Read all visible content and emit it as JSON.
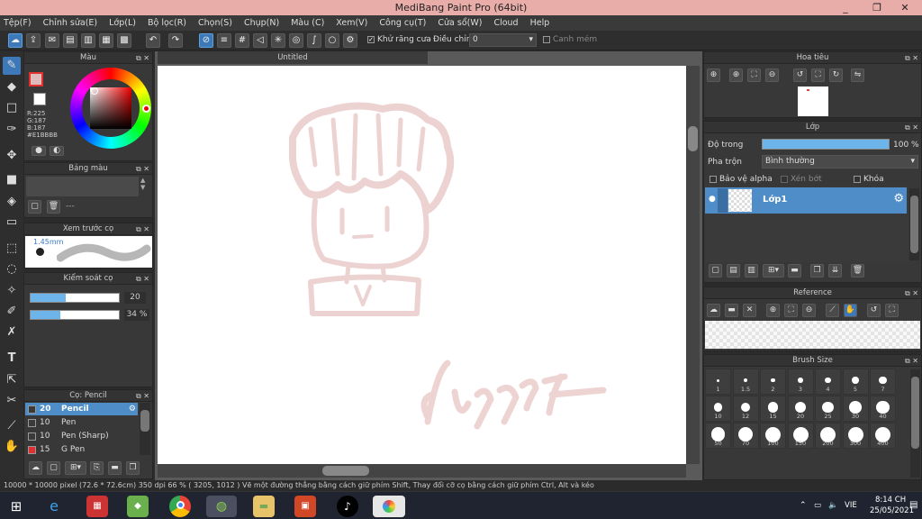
{
  "window": {
    "title": "MediBang Paint Pro (64bit)",
    "min": "_",
    "max": "❐",
    "close": "✕"
  },
  "menu": [
    "Tệp(F)",
    "Chỉnh sửa(E)",
    "Lớp(L)",
    "Bộ lọc(R)",
    "Chọn(S)",
    "Chụp(N)",
    "Màu (C)",
    "Xem(V)",
    "Công cụ(T)",
    "Cửa sổ(W)",
    "Cloud",
    "Help"
  ],
  "toolbar": {
    "antialias_label": "Khử răng cưa",
    "antialias_checked": true,
    "correction_label": "Điều chỉnh",
    "correction_value": "0",
    "snap_label": "Canh mém"
  },
  "color_panel": {
    "title": "Màu",
    "r": "R:225",
    "g": "G:187",
    "b": "B:187",
    "hex": "#E1BBBB",
    "fg": "#e1bbbb",
    "bg": "#ffffff"
  },
  "palette_panel": {
    "title": "Bảng màu",
    "value": "---"
  },
  "brush_preview": {
    "title": "Xem trước cọ",
    "size": "1.45mm"
  },
  "brush_control": {
    "title": "Kiểm soát cọ",
    "size_value": "20",
    "size_fraction": 0.4,
    "opacity_value": "34 %",
    "opacity_fraction": 0.34
  },
  "brush_panel": {
    "title": "Cọ: Pencil",
    "items": [
      {
        "size": "20",
        "name": "Pencil",
        "selected": true,
        "swatch": "#3a3a3a"
      },
      {
        "size": "10",
        "name": "Pen",
        "selected": false,
        "swatch": "#3a3a3a"
      },
      {
        "size": "10",
        "name": "Pen (Sharp)",
        "selected": false,
        "swatch": "#3a3a3a"
      },
      {
        "size": "15",
        "name": "G Pen",
        "selected": false,
        "swatch": "#e03030"
      }
    ]
  },
  "document": {
    "tab": "Untitled"
  },
  "navigator": {
    "title": "Hoa tiêu"
  },
  "layer_panel": {
    "title": "Lớp",
    "opacity_label": "Độ trong",
    "opacity_value": "100 %",
    "opacity_fraction": 1.0,
    "blend_label": "Pha trộn",
    "blend_value": "Bình thường",
    "protect_alpha": "Bảo vệ alpha",
    "clip": "Xén bớt",
    "lock": "Khóa",
    "layers": [
      {
        "name": "Lớp1"
      }
    ]
  },
  "reference_panel": {
    "title": "Reference"
  },
  "brush_size_panel": {
    "title": "Brush Size",
    "sizes": [
      "1",
      "1.5",
      "2",
      "3",
      "4",
      "5",
      "7",
      "10",
      "12",
      "15",
      "20",
      "25",
      "30",
      "40",
      "50",
      "70",
      "100",
      "150",
      "200",
      "300",
      "400"
    ]
  },
  "status": "10000 * 10000 pixel   (72.6 * 72.6cm)   350 dpi   66 %   ( 3205, 1012 )   Vẽ một đường thẳng bằng cách giữ phím Shift, Thay đổi cỡ cọ bằng cách giữ phím Ctrl, Alt và kéo",
  "taskbar": {
    "lang": "VIE",
    "time": "8:14 CH",
    "date": "25/05/2021"
  },
  "stroke_color": "#e8c4c4"
}
